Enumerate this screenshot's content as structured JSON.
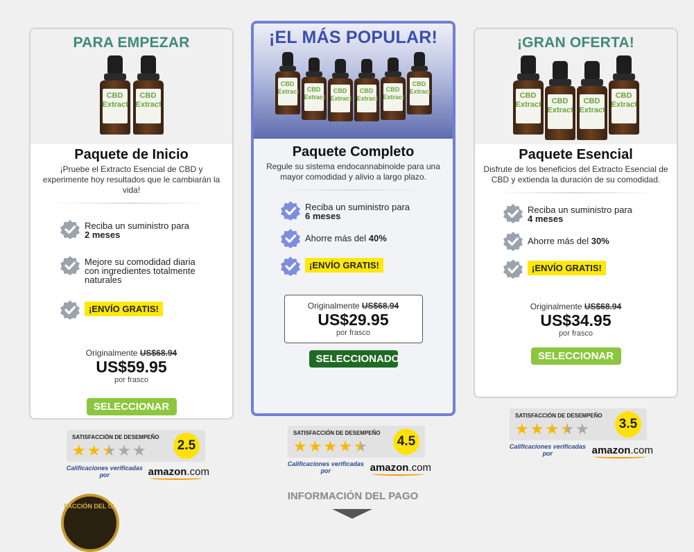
{
  "packages": [
    {
      "heading": "PARA EMPEZAR",
      "title": "Paquete de Inicio",
      "description": "¡Pruebe el Extracto Esencial de CBD y experimente hoy resultados que le cambiarán la vida!",
      "features": [
        {
          "text": "Reciba un suministro para",
          "bold": "2 meses"
        },
        {
          "text": "Mejore su comodidad diaria con ingredientes totalmente naturales",
          "bold": ""
        },
        {
          "text": "",
          "bold": "",
          "badge": "¡ENVÍO GRATIS!"
        }
      ],
      "original_label": "Originalmente",
      "original_price": "US$68.94",
      "price": "US$59.95",
      "per": "por frasco",
      "button": "SELECCIONAR",
      "rating_label": "SATISFACCIÓN DE DESEMPEÑO",
      "rating": "2.5",
      "rating_value": 2.5
    },
    {
      "heading": "¡EL MÁS POPULAR!",
      "title": "Paquete Completo",
      "description": "Regule su sistema endocannabinoide para una mayor comodidad y alivio a largo plazo.",
      "features": [
        {
          "text": "Reciba un suministro para",
          "bold": "6 meses"
        },
        {
          "text": "Ahorre más del",
          "bold": "40%"
        },
        {
          "text": "",
          "bold": "",
          "badge": "¡ENVÍO GRATIS!"
        }
      ],
      "original_label": "Originalmente",
      "original_price": "US$68.94",
      "price": "US$29.95",
      "per": "por frasco",
      "button": "SELECCIONADO",
      "rating_label": "SATISFACCIÓN DE DESEMPEÑO",
      "rating": "4.5",
      "rating_value": 4.5
    },
    {
      "heading": "¡GRAN OFERTA!",
      "title": "Paquete Esencial",
      "description": "Disfrute de los beneficios del Extracto Esencial de CBD y extienda la duración de su comodidad.",
      "features": [
        {
          "text": "Reciba un suministro para",
          "bold": "4 meses"
        },
        {
          "text": "Ahorre más del",
          "bold": "30%"
        },
        {
          "text": "",
          "bold": "",
          "badge": "¡ENVÍO GRATIS!"
        }
      ],
      "original_label": "Originalmente",
      "original_price": "US$68.94",
      "price": "US$34.95",
      "per": "por frasco",
      "button": "SELECCIONAR",
      "rating_label": "SATISFACCIÓN DE DESEMPEÑO",
      "rating": "3.5",
      "rating_value": 3.5
    }
  ],
  "bottle_label": "CBD\nExtract",
  "verified_text": "Calificaciones verificadas por",
  "amazon_brand": "amazon",
  "amazon_tld": ".com",
  "payment_info": "INFORMACIÓN DEL PAGO",
  "seal_text": "FACCIÓN DEL CL",
  "colors": {
    "accent_green": "#3e8a77",
    "popular_blue": "#3a4db0",
    "button_green": "#8cc63f",
    "selected_green": "#1f6b23",
    "highlight_yellow": "#ffe80a",
    "star": "#f6b900"
  }
}
